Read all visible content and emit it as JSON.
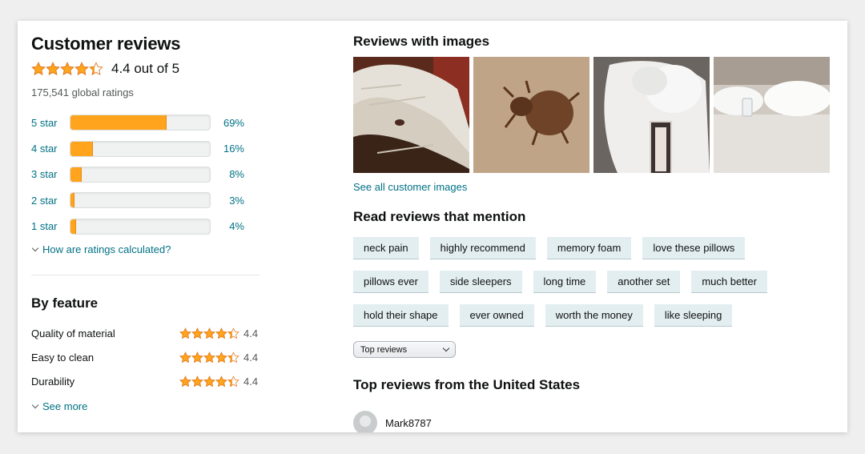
{
  "colors": {
    "link": "#007185",
    "star": "#ffa41c",
    "chip_bg": "#e3eef1"
  },
  "reviews": {
    "title": "Customer reviews",
    "average_rating": 4.4,
    "average_label": "4.4 out of 5",
    "global_ratings": "175,541 global ratings",
    "histogram": [
      {
        "label": "5 star",
        "percent": 69,
        "percent_label": "69%"
      },
      {
        "label": "4 star",
        "percent": 16,
        "percent_label": "16%"
      },
      {
        "label": "3 star",
        "percent": 8,
        "percent_label": "8%"
      },
      {
        "label": "2 star",
        "percent": 3,
        "percent_label": "3%"
      },
      {
        "label": "1 star",
        "percent": 4,
        "percent_label": "4%"
      }
    ],
    "how_calculated": "How are ratings calculated?"
  },
  "by_feature": {
    "title": "By feature",
    "features": [
      {
        "name": "Quality of material",
        "rating": 4.4,
        "rating_label": "4.4"
      },
      {
        "name": "Easy to clean",
        "rating": 4.4,
        "rating_label": "4.4"
      },
      {
        "name": "Durability",
        "rating": 4.4,
        "rating_label": "4.4"
      }
    ],
    "see_more": "See more"
  },
  "images": {
    "title": "Reviews with images",
    "thumbnails": [
      "crumpled-white-sheet-photo",
      "bed-bug-closeup-photo",
      "pillow-stuffing-photo",
      "pillows-on-bed-photo"
    ],
    "see_all": "See all customer images"
  },
  "mentions": {
    "title": "Read reviews that mention",
    "rows": [
      [
        "neck pain",
        "highly recommend",
        "memory foam",
        "love these pillows"
      ],
      [
        "pillows ever",
        "side sleepers",
        "long time",
        "another set",
        "much better"
      ],
      [
        "hold their shape",
        "ever owned",
        "worth the money",
        "like sleeping"
      ]
    ]
  },
  "sort": {
    "selected": "Top reviews"
  },
  "top_reviews": {
    "title": "Top reviews from the United States",
    "first_reviewer": "Mark8787"
  }
}
